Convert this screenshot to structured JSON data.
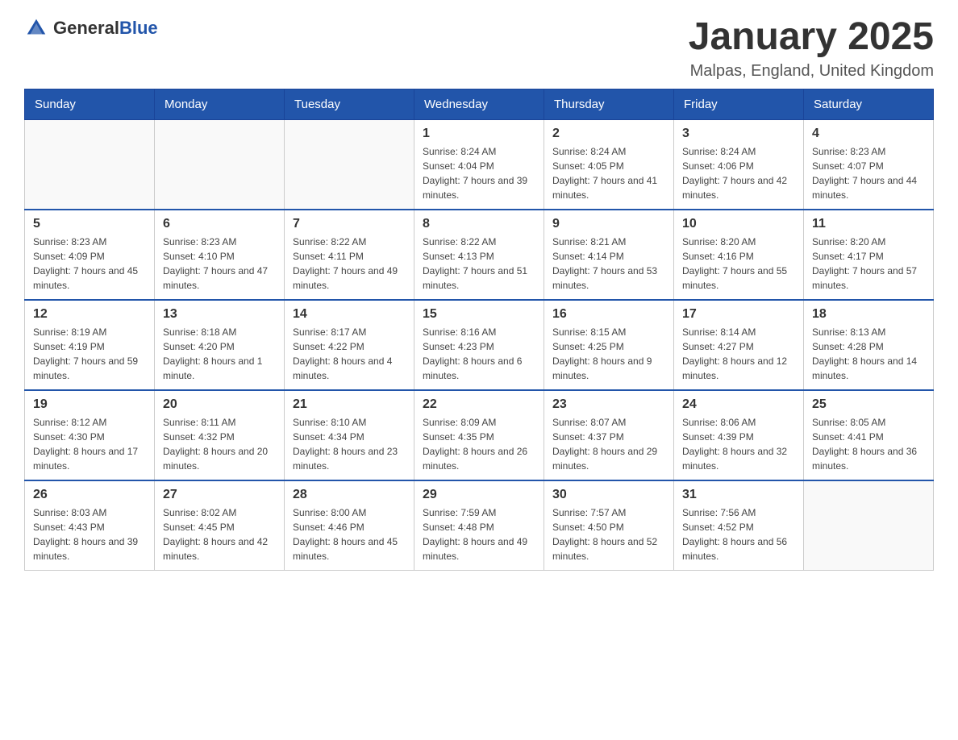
{
  "header": {
    "logo": {
      "general": "General",
      "blue": "Blue"
    },
    "title": "January 2025",
    "location": "Malpas, England, United Kingdom"
  },
  "calendar": {
    "days_of_week": [
      "Sunday",
      "Monday",
      "Tuesday",
      "Wednesday",
      "Thursday",
      "Friday",
      "Saturday"
    ],
    "weeks": [
      [
        {
          "day": "",
          "info": ""
        },
        {
          "day": "",
          "info": ""
        },
        {
          "day": "",
          "info": ""
        },
        {
          "day": "1",
          "info": "Sunrise: 8:24 AM\nSunset: 4:04 PM\nDaylight: 7 hours and 39 minutes."
        },
        {
          "day": "2",
          "info": "Sunrise: 8:24 AM\nSunset: 4:05 PM\nDaylight: 7 hours and 41 minutes."
        },
        {
          "day": "3",
          "info": "Sunrise: 8:24 AM\nSunset: 4:06 PM\nDaylight: 7 hours and 42 minutes."
        },
        {
          "day": "4",
          "info": "Sunrise: 8:23 AM\nSunset: 4:07 PM\nDaylight: 7 hours and 44 minutes."
        }
      ],
      [
        {
          "day": "5",
          "info": "Sunrise: 8:23 AM\nSunset: 4:09 PM\nDaylight: 7 hours and 45 minutes."
        },
        {
          "day": "6",
          "info": "Sunrise: 8:23 AM\nSunset: 4:10 PM\nDaylight: 7 hours and 47 minutes."
        },
        {
          "day": "7",
          "info": "Sunrise: 8:22 AM\nSunset: 4:11 PM\nDaylight: 7 hours and 49 minutes."
        },
        {
          "day": "8",
          "info": "Sunrise: 8:22 AM\nSunset: 4:13 PM\nDaylight: 7 hours and 51 minutes."
        },
        {
          "day": "9",
          "info": "Sunrise: 8:21 AM\nSunset: 4:14 PM\nDaylight: 7 hours and 53 minutes."
        },
        {
          "day": "10",
          "info": "Sunrise: 8:20 AM\nSunset: 4:16 PM\nDaylight: 7 hours and 55 minutes."
        },
        {
          "day": "11",
          "info": "Sunrise: 8:20 AM\nSunset: 4:17 PM\nDaylight: 7 hours and 57 minutes."
        }
      ],
      [
        {
          "day": "12",
          "info": "Sunrise: 8:19 AM\nSunset: 4:19 PM\nDaylight: 7 hours and 59 minutes."
        },
        {
          "day": "13",
          "info": "Sunrise: 8:18 AM\nSunset: 4:20 PM\nDaylight: 8 hours and 1 minute."
        },
        {
          "day": "14",
          "info": "Sunrise: 8:17 AM\nSunset: 4:22 PM\nDaylight: 8 hours and 4 minutes."
        },
        {
          "day": "15",
          "info": "Sunrise: 8:16 AM\nSunset: 4:23 PM\nDaylight: 8 hours and 6 minutes."
        },
        {
          "day": "16",
          "info": "Sunrise: 8:15 AM\nSunset: 4:25 PM\nDaylight: 8 hours and 9 minutes."
        },
        {
          "day": "17",
          "info": "Sunrise: 8:14 AM\nSunset: 4:27 PM\nDaylight: 8 hours and 12 minutes."
        },
        {
          "day": "18",
          "info": "Sunrise: 8:13 AM\nSunset: 4:28 PM\nDaylight: 8 hours and 14 minutes."
        }
      ],
      [
        {
          "day": "19",
          "info": "Sunrise: 8:12 AM\nSunset: 4:30 PM\nDaylight: 8 hours and 17 minutes."
        },
        {
          "day": "20",
          "info": "Sunrise: 8:11 AM\nSunset: 4:32 PM\nDaylight: 8 hours and 20 minutes."
        },
        {
          "day": "21",
          "info": "Sunrise: 8:10 AM\nSunset: 4:34 PM\nDaylight: 8 hours and 23 minutes."
        },
        {
          "day": "22",
          "info": "Sunrise: 8:09 AM\nSunset: 4:35 PM\nDaylight: 8 hours and 26 minutes."
        },
        {
          "day": "23",
          "info": "Sunrise: 8:07 AM\nSunset: 4:37 PM\nDaylight: 8 hours and 29 minutes."
        },
        {
          "day": "24",
          "info": "Sunrise: 8:06 AM\nSunset: 4:39 PM\nDaylight: 8 hours and 32 minutes."
        },
        {
          "day": "25",
          "info": "Sunrise: 8:05 AM\nSunset: 4:41 PM\nDaylight: 8 hours and 36 minutes."
        }
      ],
      [
        {
          "day": "26",
          "info": "Sunrise: 8:03 AM\nSunset: 4:43 PM\nDaylight: 8 hours and 39 minutes."
        },
        {
          "day": "27",
          "info": "Sunrise: 8:02 AM\nSunset: 4:45 PM\nDaylight: 8 hours and 42 minutes."
        },
        {
          "day": "28",
          "info": "Sunrise: 8:00 AM\nSunset: 4:46 PM\nDaylight: 8 hours and 45 minutes."
        },
        {
          "day": "29",
          "info": "Sunrise: 7:59 AM\nSunset: 4:48 PM\nDaylight: 8 hours and 49 minutes."
        },
        {
          "day": "30",
          "info": "Sunrise: 7:57 AM\nSunset: 4:50 PM\nDaylight: 8 hours and 52 minutes."
        },
        {
          "day": "31",
          "info": "Sunrise: 7:56 AM\nSunset: 4:52 PM\nDaylight: 8 hours and 56 minutes."
        },
        {
          "day": "",
          "info": ""
        }
      ]
    ]
  }
}
